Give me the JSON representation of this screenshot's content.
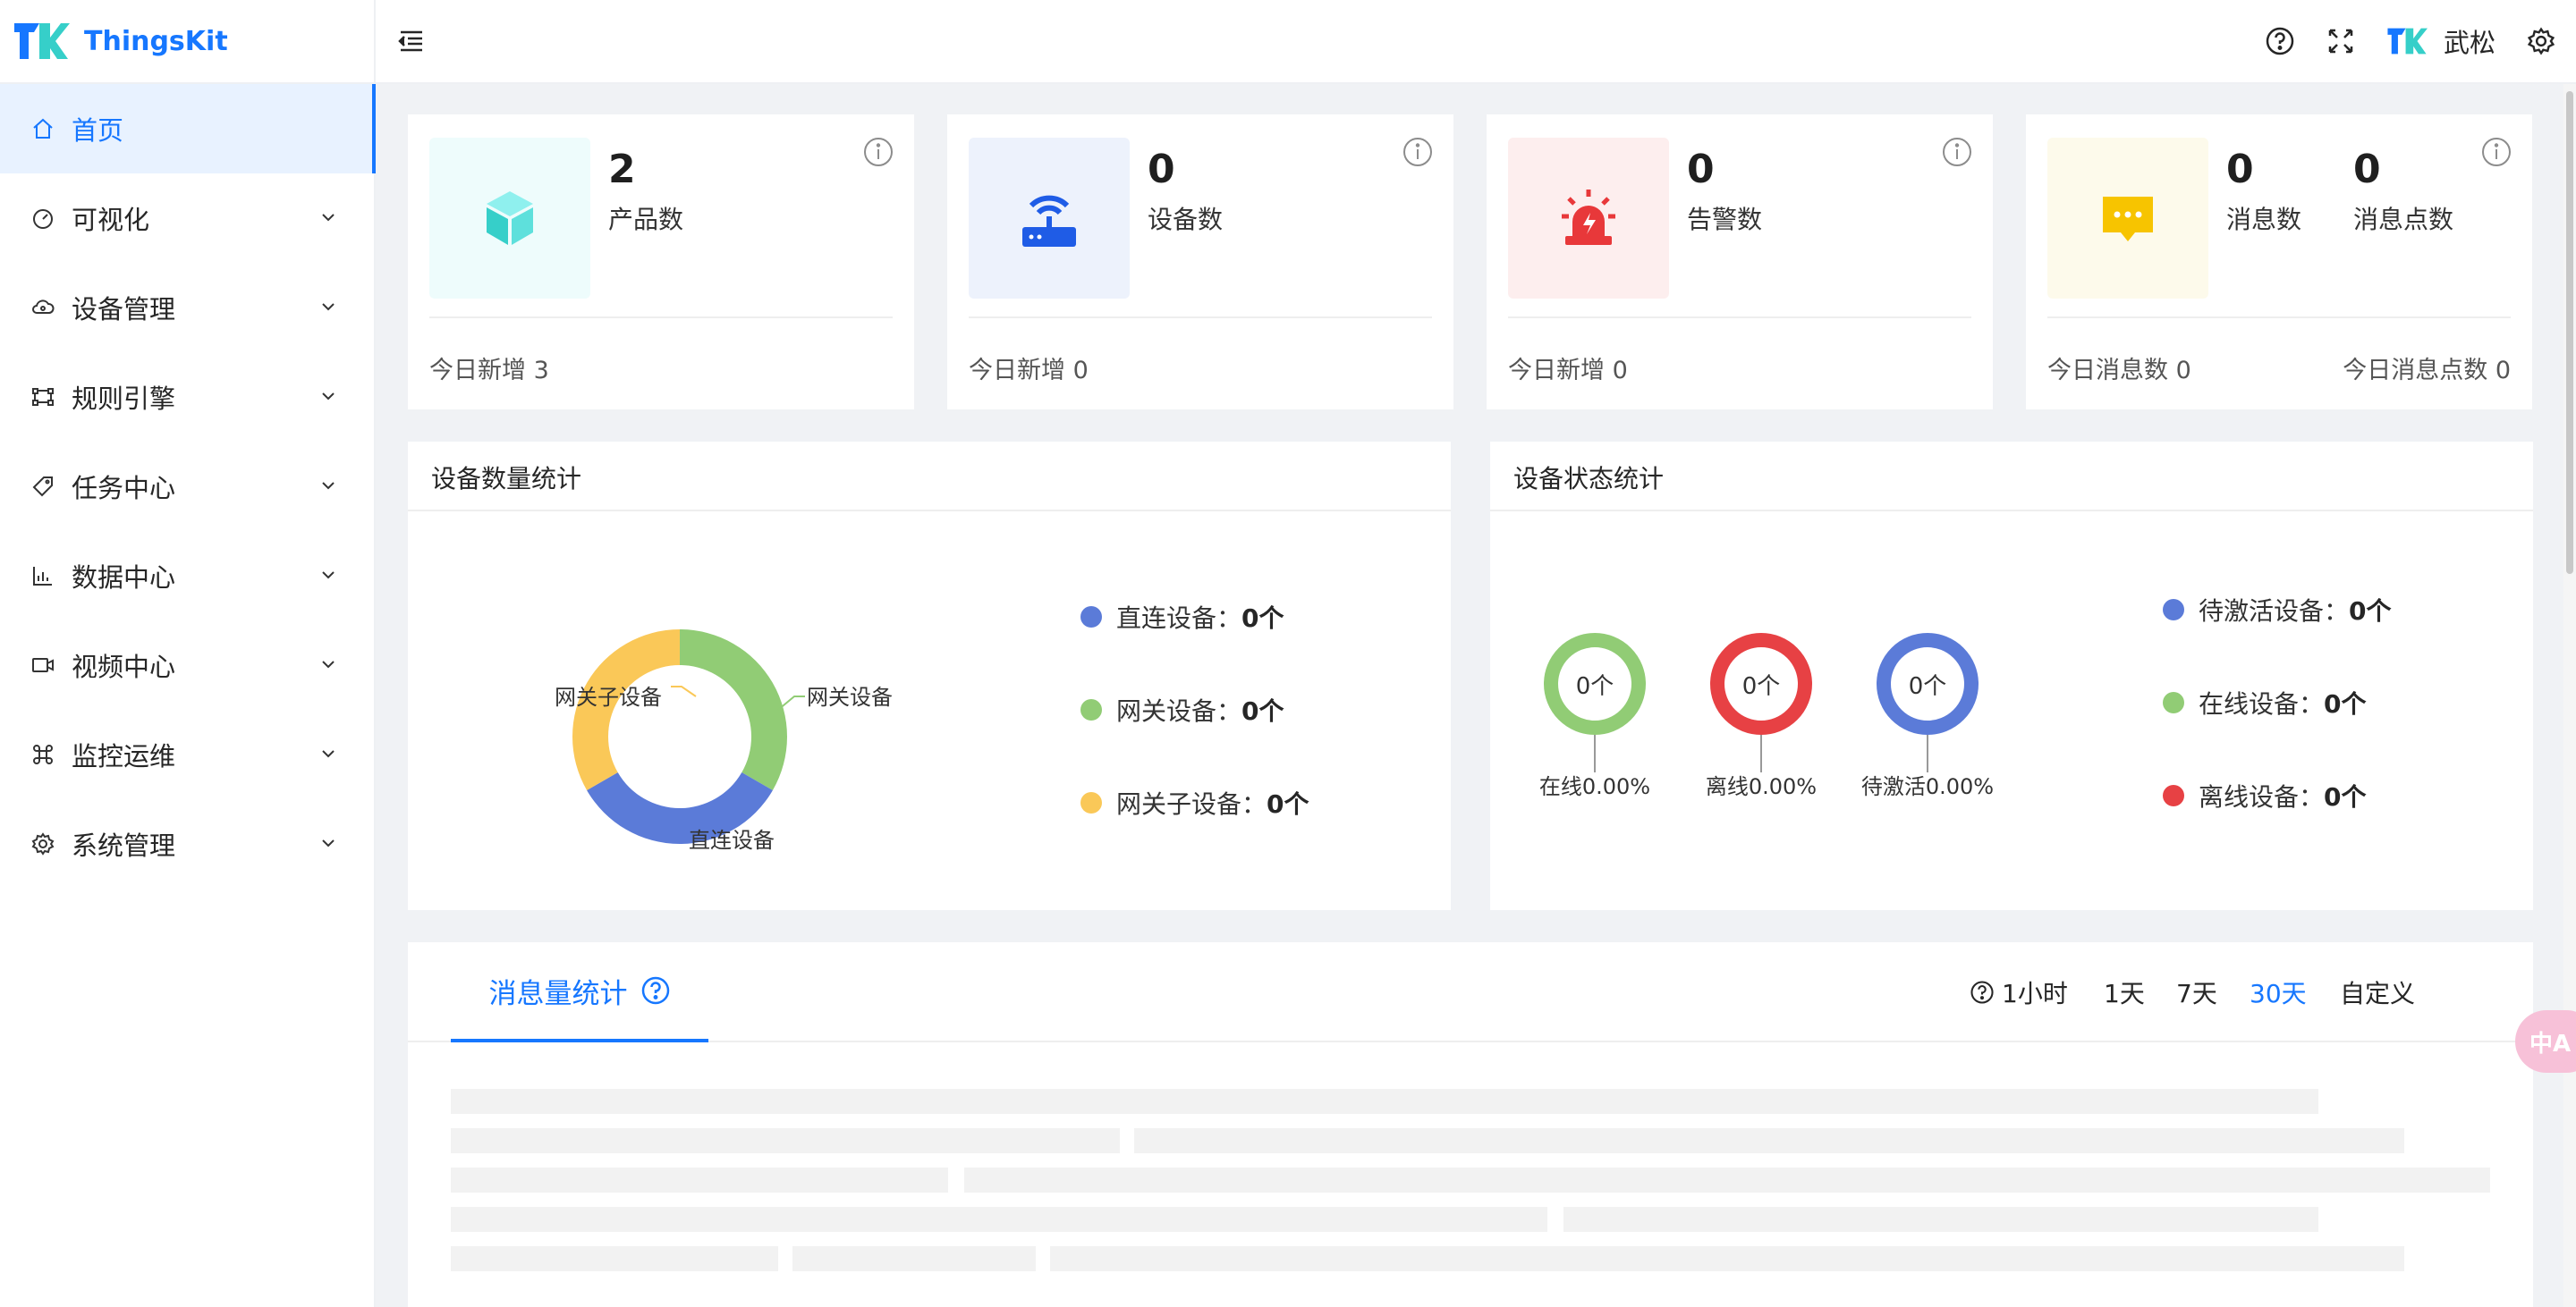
{
  "app": {
    "brand": "ThingsKit"
  },
  "sidebar": {
    "items": [
      {
        "label": "首页",
        "icon": "home-icon",
        "active": true
      },
      {
        "label": "可视化",
        "icon": "dashboard-icon"
      },
      {
        "label": "设备管理",
        "icon": "cloud-device-icon"
      },
      {
        "label": "规则引擎",
        "icon": "flow-icon"
      },
      {
        "label": "任务中心",
        "icon": "tag-icon"
      },
      {
        "label": "数据中心",
        "icon": "bar-chart-icon"
      },
      {
        "label": "视频中心",
        "icon": "video-icon"
      },
      {
        "label": "监控运维",
        "icon": "command-icon"
      },
      {
        "label": "系统管理",
        "icon": "gear-icon"
      }
    ]
  },
  "header": {
    "user_name": "武松"
  },
  "stats": {
    "product": {
      "value": "2",
      "label": "产品数",
      "footer": "今日新增 3"
    },
    "device": {
      "value": "0",
      "label": "设备数",
      "footer": "今日新增 0"
    },
    "alarm": {
      "value": "0",
      "label": "告警数",
      "footer": "今日新增 0"
    },
    "message": {
      "value": "0",
      "label": "消息数",
      "value2": "0",
      "label2": "消息点数",
      "footer": "今日消息数 0",
      "footer2": "今日消息点数 0"
    }
  },
  "device_count_panel": {
    "title": "设备数量统计",
    "labels": {
      "direct": "直连设备",
      "gateway": "网关设备",
      "sub": "网关子设备"
    },
    "legend": [
      {
        "label": "直连设备：",
        "value": "0个",
        "color": "#5b7bd8"
      },
      {
        "label": "网关设备：",
        "value": "0个",
        "color": "#91cc75"
      },
      {
        "label": "网关子设备：",
        "value": "0个",
        "color": "#fac858"
      }
    ]
  },
  "device_status_panel": {
    "title": "设备状态统计",
    "gauges": [
      {
        "value": "0个",
        "caption": "在线0.00%",
        "color": "#91cc75"
      },
      {
        "value": "0个",
        "caption": "离线0.00%",
        "color": "#e74144"
      },
      {
        "value": "0个",
        "caption": "待激活0.00%",
        "color": "#5b7bd8"
      }
    ],
    "legend": [
      {
        "label": "待激活设备：",
        "value": "0个",
        "color": "#5b7bd8"
      },
      {
        "label": "在线设备：",
        "value": "0个",
        "color": "#91cc75"
      },
      {
        "label": "离线设备：",
        "value": "0个",
        "color": "#e74144"
      }
    ]
  },
  "message_panel": {
    "tab": "消息量统计",
    "ranges": [
      "1小时",
      "1天",
      "7天",
      "30天",
      "自定义"
    ],
    "selected_range": "30天"
  },
  "chart_data": {
    "type": "pie",
    "title": "设备数量统计",
    "categories": [
      "直连设备",
      "网关设备",
      "网关子设备"
    ],
    "values": [
      0,
      0,
      0
    ],
    "colors": [
      "#5b7bd8",
      "#91cc75",
      "#fac858"
    ]
  },
  "colors": {
    "accent": "#1677ff"
  }
}
